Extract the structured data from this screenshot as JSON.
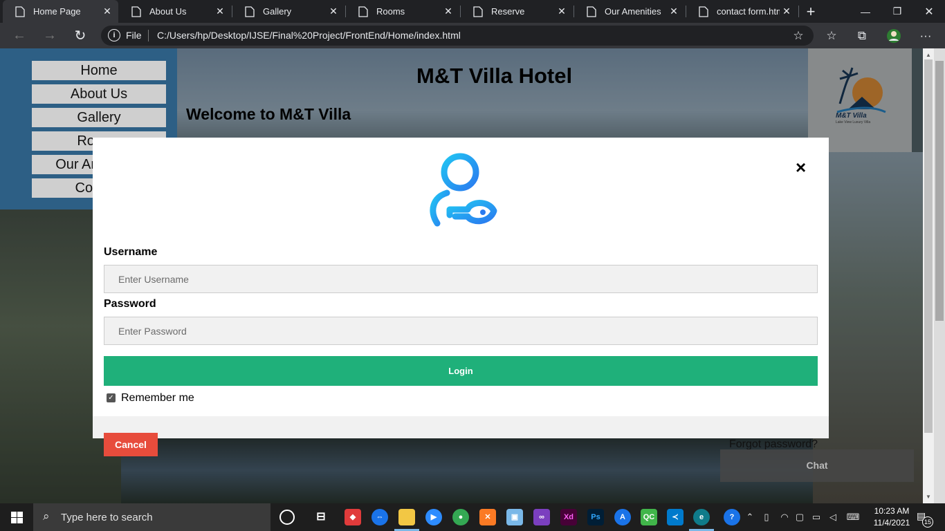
{
  "browser": {
    "tabs": [
      {
        "label": "Home Page",
        "active": true
      },
      {
        "label": "About Us",
        "active": false
      },
      {
        "label": "Gallery",
        "active": false
      },
      {
        "label": "Rooms",
        "active": false
      },
      {
        "label": "Reserve",
        "active": false
      },
      {
        "label": "Our Amenities",
        "active": false
      },
      {
        "label": "contact form.html",
        "active": false
      }
    ],
    "new_tab": "+",
    "window": {
      "minimize": "—",
      "maximize": "❐",
      "close": "✕"
    },
    "address": {
      "scheme_label": "File",
      "url": "C:/Users/hp/Desktop/IJSE/Final%20Project/FrontEnd/Home/index.html"
    },
    "toolbar": {
      "back": "←",
      "forward": "→",
      "reload": "↻",
      "fav_add": "☆",
      "favorites": "☆",
      "collections": "⧉",
      "menu": "···"
    }
  },
  "site": {
    "nav": [
      "Home",
      "About Us",
      "Gallery",
      "Rooms",
      "Our Amenities",
      "Contact"
    ],
    "title": "M&T Villa Hotel",
    "welcome": "Welcome to M&T Villa",
    "logo": {
      "name": "M&T Villa",
      "tagline": "Lake View Luxury Villa"
    },
    "carousel": {
      "prev": "‹",
      "next": "›"
    },
    "chat_label": "Chat"
  },
  "login_modal": {
    "close": "×",
    "username_label": "Username",
    "username_placeholder": "Enter Username",
    "password_label": "Password",
    "password_placeholder": "Enter Password",
    "login_button": "Login",
    "remember_label": "Remember me",
    "remember_checked": true,
    "cancel_button": "Cancel",
    "forgot_link": "Forgot password?"
  },
  "taskbar": {
    "search_placeholder": "Type here to search",
    "time": "10:23 AM",
    "date": "11/4/2021",
    "notification_count": "15"
  },
  "colors": {
    "login_green": "#1fb07a",
    "cancel_red": "#e74c3c",
    "nav_blue": "#2d5f85",
    "avatar_gradient_start": "#21c4f2",
    "avatar_gradient_end": "#2a7bf0"
  }
}
